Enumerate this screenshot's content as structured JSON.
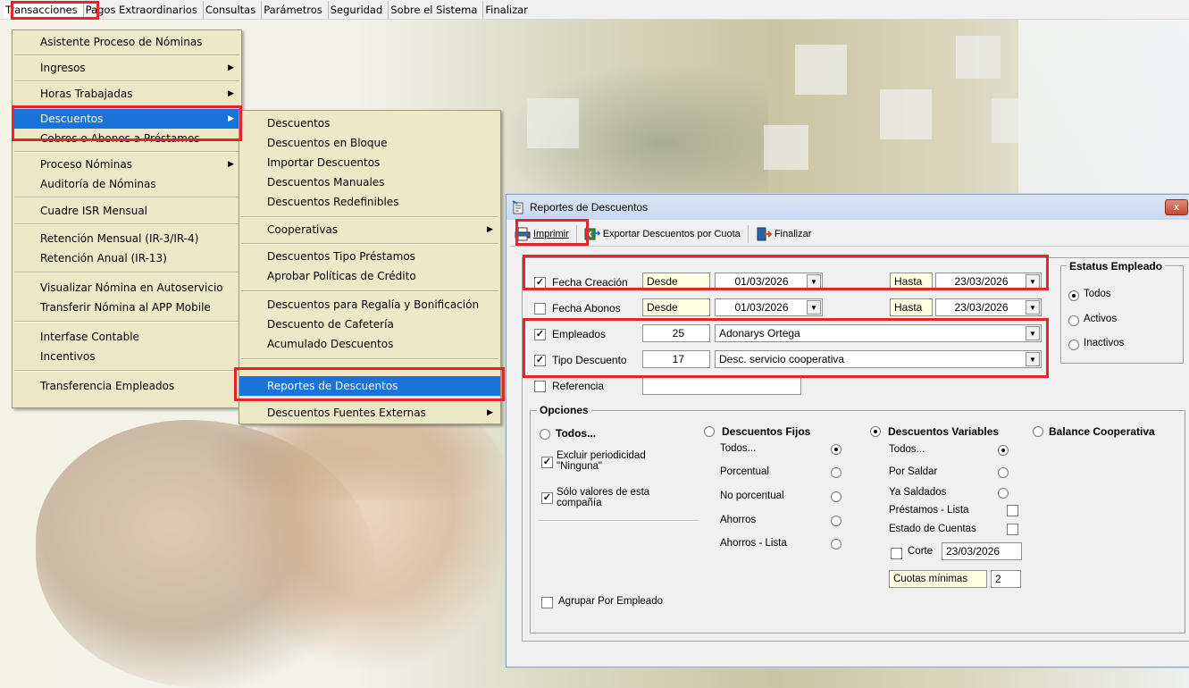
{
  "menubar": {
    "items": [
      "Transacciones",
      "Pagos Extraordinarios",
      "Consultas",
      "Parámetros",
      "Seguridad",
      "Sobre el Sistema",
      "Finalizar"
    ]
  },
  "transacciones_menu": {
    "items": [
      "Asistente Proceso de Nóminas",
      "Ingresos",
      "Horas Trabajadas",
      "Descuentos",
      "Cobros o Abonos a Préstamos",
      "Proceso Nóminas",
      "Auditoría de Nóminas",
      "Cuadre ISR Mensual",
      "Retención Mensual  (IR-3/IR-4)",
      "Retención Anual  (IR-13)",
      "Visualizar Nómina en Autoservicio",
      "Transferir Nómina al APP Mobile",
      "Interfase Contable",
      "Incentivos",
      "Transferencia Empleados"
    ]
  },
  "descuentos_menu": {
    "items": [
      "Descuentos",
      "Descuentos en Bloque",
      "Importar Descuentos",
      "Descuentos Manuales",
      "Descuentos Redefinibles",
      "Cooperativas",
      "Descuentos Tipo Préstamos",
      "Aprobar Políticas de Crédito",
      "Descuentos  para Regalía y Bonificación",
      "Descuento de Cafetería",
      "Acumulado Descuentos",
      "Reportes de Descuentos",
      "Descuentos Fuentes Externas"
    ]
  },
  "dialog": {
    "title": "Reportes de Descuentos",
    "close": "x",
    "toolbar": {
      "imprimir": "Imprimir",
      "exportar": "Exportar Descuentos por Cuota",
      "finalizar": "Finalizar"
    },
    "filters": {
      "fecha_creacion": {
        "label": "Fecha Creación",
        "checked": "✓",
        "desde_label": "Desde",
        "desde": "01/03/2026",
        "hasta_label": "Hasta",
        "hasta": "23/03/2026"
      },
      "fecha_abonos": {
        "label": "Fecha Abonos",
        "checked": "",
        "desde_label": "Desde",
        "desde": "01/03/2026",
        "hasta_label": "Hasta",
        "hasta": "23/03/2026"
      },
      "empleados": {
        "label": "Empleados",
        "checked": "✓",
        "code": "25",
        "name": "Adonarys Ortega"
      },
      "tipo_descuento": {
        "label": "Tipo Descuento",
        "checked": "✓",
        "code": "17",
        "name": "Desc. servicio cooperativa"
      },
      "referencia": {
        "label": "Referencia",
        "checked": "",
        "value": ""
      }
    },
    "estatus_empleado": {
      "title": "Estatus Empleado",
      "options": [
        "Todos",
        "Activos",
        "Inactivos"
      ],
      "selected": "Todos"
    },
    "opciones": {
      "title": "Opciones",
      "todos": {
        "label": "Todos...",
        "excluir": "Excluir periodicidad \"Ninguna\"",
        "solo": "Sólo valores de esta compañía",
        "agrupar": "Agrupar Por Empleado"
      },
      "fijos": {
        "label": "Descuentos Fijos",
        "options": [
          "Todos...",
          "Porcentual",
          "No porcentual",
          "Ahorros",
          "Ahorros - Lista"
        ]
      },
      "variables": {
        "label": "Descuentos Variables",
        "options": [
          "Todos...",
          "Por Saldar",
          "Ya Saldados"
        ],
        "checks": [
          "Préstamos - Lista",
          "Estado de Cuentas"
        ],
        "corte_label": "Corte",
        "corte_date": "23/03/2026",
        "cuotas_label": "Cuotas mínimas",
        "cuotas_value": "2"
      },
      "balance": {
        "label": "Balance Cooperativa"
      },
      "selected": "Descuentos Variables"
    }
  }
}
